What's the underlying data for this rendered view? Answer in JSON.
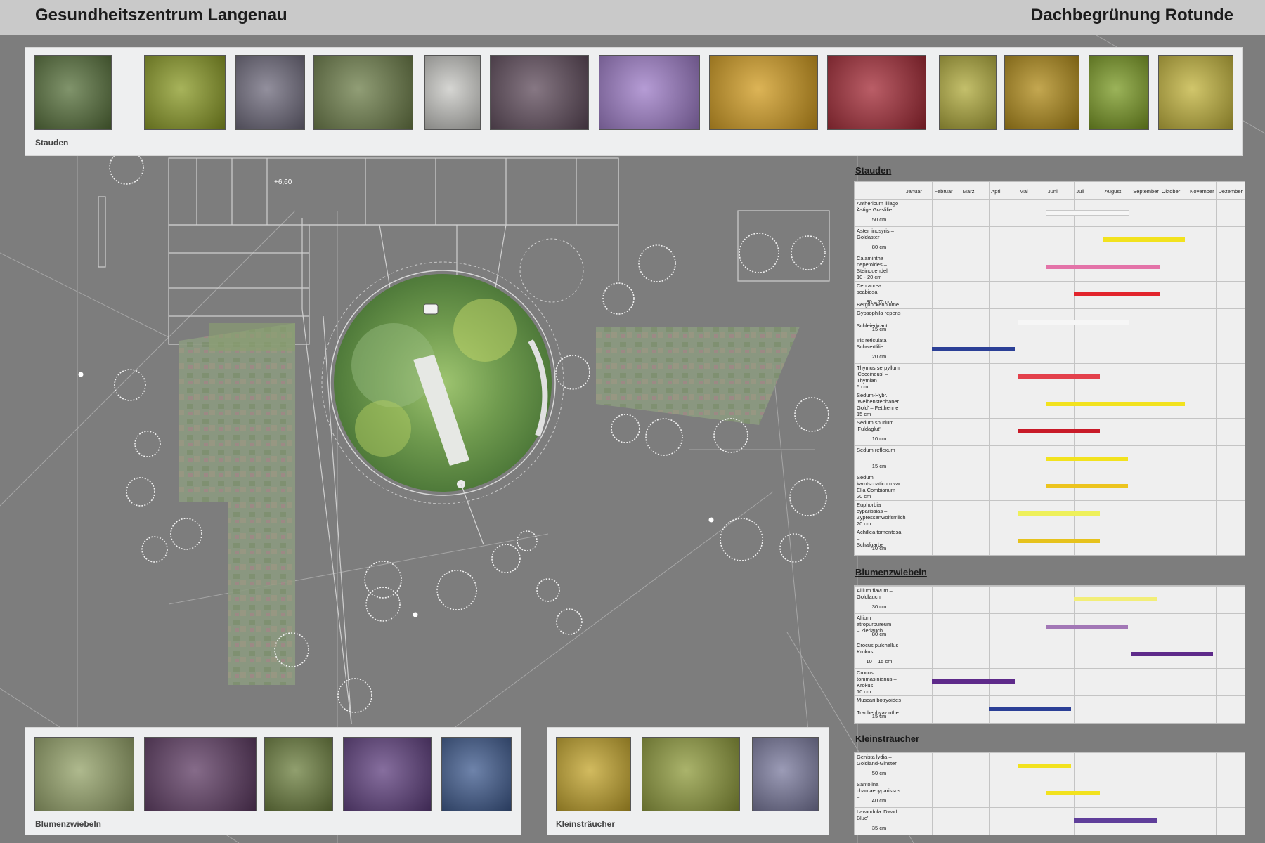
{
  "header": {
    "title_left": "Gesundheitszentrum Langenau",
    "title_right": "Dachbegrünung Rotunde"
  },
  "plan": {
    "height_label": "+6,60"
  },
  "gallery_stauden": {
    "label": "Stauden",
    "photos": [
      "white-lily-flower",
      "yellow-aster-flowers",
      "lilac-calamint",
      "purple-knapweed",
      "white-gypsophila",
      "purple-iris",
      "pink-thyme",
      "yellow-sedum",
      "red-sedum",
      "yellow-santolina",
      "yellow-sedum-carpet",
      "green-euphorbia",
      "yellow-achillea"
    ],
    "colors": [
      "#56703a",
      "#8a9a24",
      "#6e6a7c",
      "#6c7d48",
      "#c8c8c4",
      "#5e4a5a",
      "#9d7bc7",
      "#d19b1e",
      "#a32834",
      "#b0aa3a",
      "#b08a16",
      "#7a9a22",
      "#c2b33a"
    ]
  },
  "gallery_zwiebeln": {
    "label": "Blumenzwiebeln",
    "photos": [
      "yellow-allium",
      "purple-allium",
      "pale-crocus",
      "violet-crocus",
      "blue-muscari"
    ],
    "colors": [
      "#94a268",
      "#5d3a62",
      "#6c7f3e",
      "#5e3e7e",
      "#3e5a8e"
    ]
  },
  "gallery_straeucher": {
    "label": "Kleinsträucher",
    "photos": [
      "yellow-genista",
      "santolina-green",
      "lavender"
    ],
    "colors": [
      "#c3a42a",
      "#8e9a3a",
      "#7a7a9e"
    ]
  },
  "months": [
    "Januar",
    "Februar",
    "März",
    "April",
    "Mai",
    "Juni",
    "Juli",
    "August",
    "September",
    "Oktober",
    "November",
    "Dezember"
  ],
  "sections": [
    {
      "title": "Stauden",
      "plants": [
        {
          "name": "Anthericum liliago –\nÄstige Graslilie",
          "height": "50 cm",
          "start": 6,
          "end": 7.9,
          "color": "#f6f6f6"
        },
        {
          "name": "Aster linosyris –\nGoldaster",
          "height": "80 cm",
          "start": 8,
          "end": 9.9,
          "color": "#f2e21e"
        },
        {
          "name": "Calamintha\nnepetoides –\nSteinquendel\n10 - 20 cm",
          "height": "",
          "start": 6,
          "end": 9,
          "color": "#e373a8"
        },
        {
          "name": "Centaurea scabiosa\n– Bergflockenblume",
          "height": "30 – 70 cm",
          "start": 7,
          "end": 9,
          "color": "#e2242c"
        },
        {
          "name": "Gypsophila repens –\nSchleierkraut",
          "height": "15 cm",
          "start": 5,
          "end": 7.9,
          "color": "#f6f6f6"
        },
        {
          "name": "Iris reticulata –\nSchwertlilie",
          "height": "20 cm",
          "start": 2,
          "end": 3.9,
          "color": "#2b3f96"
        },
        {
          "name": "Thymus serpyllum\n'Coccineus' –\nThymian\n5 cm",
          "height": "",
          "start": 5,
          "end": 6.9,
          "color": "#e3404b"
        },
        {
          "name": "Sedum-Hybr.\n'Weihenstephaner\nGold' – Fetthenne\n15 cm",
          "height": "",
          "start": 6,
          "end": 9.9,
          "color": "#f2e21e"
        },
        {
          "name": "Sedum spurium\n'Fuldaglut'",
          "height": "10 cm",
          "start": 5,
          "end": 6.9,
          "color": "#c81a28"
        },
        {
          "name": "Sedum reflexum",
          "height": "15 cm",
          "start": 6,
          "end": 7.9,
          "color": "#f2e21e"
        },
        {
          "name": "Sedum\nkamtschaticum var.\nElla Combianum\n20 cm",
          "height": "",
          "start": 6,
          "end": 7.9,
          "color": "#ecc41e"
        },
        {
          "name": "Euphorbia\ncyparissias –\nZypressenwolfsmilch\n20 cm",
          "height": "",
          "start": 5,
          "end": 6.9,
          "color": "#eef05a"
        },
        {
          "name": "Achillea tomentosa –\nSchafgarbe",
          "height": "10 cm",
          "start": 5,
          "end": 6.9,
          "color": "#e6c21c"
        }
      ]
    },
    {
      "title": "Blumenzwiebeln",
      "plants": [
        {
          "name": "Allium flavum –\nGoldlauch",
          "height": "30 cm",
          "start": 7,
          "end": 8.9,
          "color": "#f2ee78"
        },
        {
          "name": "Allium atropurpureum\n– Zierlauch",
          "height": "80 cm",
          "start": 6,
          "end": 7.9,
          "color": "#a277b6"
        },
        {
          "name": "Crocus pulchellus –\nKrokus",
          "height": "10 – 15 cm",
          "start": 9,
          "end": 10.9,
          "color": "#5e2a8a"
        },
        {
          "name": "Crocus\ntommasinianus –\nKrokus\n10 cm",
          "height": "",
          "start": 2,
          "end": 3.9,
          "color": "#5e2a8a"
        },
        {
          "name": "Muscari botryoides –\nTraubenhyazinthe",
          "height": "15 cm",
          "start": 4,
          "end": 5.9,
          "color": "#2b3f96"
        }
      ]
    },
    {
      "title": "Kleinsträucher",
      "plants": [
        {
          "name": "Genista lydia –\nGoldland-Ginster",
          "height": "50 cm",
          "start": 5,
          "end": 5.9,
          "color": "#f2e21e"
        },
        {
          "name": "Santolina\nchamaecyparissus –",
          "height": "40 cm",
          "start": 6,
          "end": 6.9,
          "color": "#f2e21e"
        },
        {
          "name": "Lavandula 'Dwarf\nBlue'",
          "height": "35 cm",
          "start": 7,
          "end": 8.9,
          "color": "#5f3e9a"
        }
      ]
    }
  ]
}
